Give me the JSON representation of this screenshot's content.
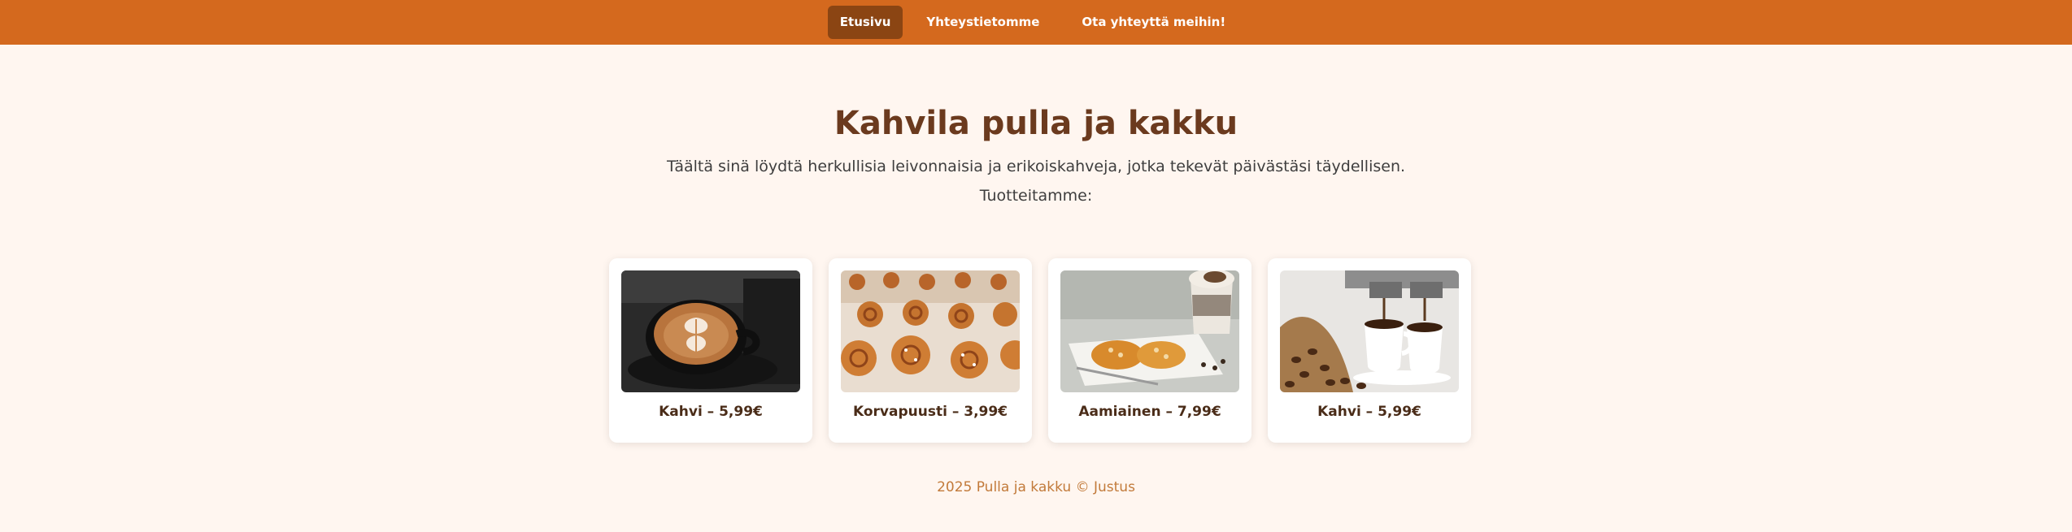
{
  "nav": {
    "items": [
      {
        "label": "Etusivu",
        "active": true
      },
      {
        "label": "Yhteystietomme",
        "active": false
      },
      {
        "label": "Ota yhteyttä meihin!",
        "active": false
      }
    ]
  },
  "hero": {
    "title": "Kahvila pulla ja kakku",
    "subtitle": "Täältä sinä löydtä herkullisia leivonnaisia ja erikoiskahveja, jotka tekevät päivästäsi täydellisen.",
    "section_label": "Tuotteitamme:"
  },
  "products": [
    {
      "caption": "Kahvi – 5,99€",
      "image": "latte-art-coffee-photo"
    },
    {
      "caption": "Korvapuusti – 3,99€",
      "image": "cinnamon-buns-photo"
    },
    {
      "caption": "Aamiainen – 7,99€",
      "image": "pastry-breakfast-photo"
    },
    {
      "caption": "Kahvi – 5,99€",
      "image": "espresso-machine-photo"
    }
  ],
  "footer": {
    "text": "2025 Pulla ja kakku © Justus"
  },
  "colors": {
    "nav_bg": "#d4691e",
    "nav_active": "#8b4513",
    "page_bg": "#fff6f0",
    "title": "#6b3a1e",
    "footer_text": "#c27a3a"
  }
}
